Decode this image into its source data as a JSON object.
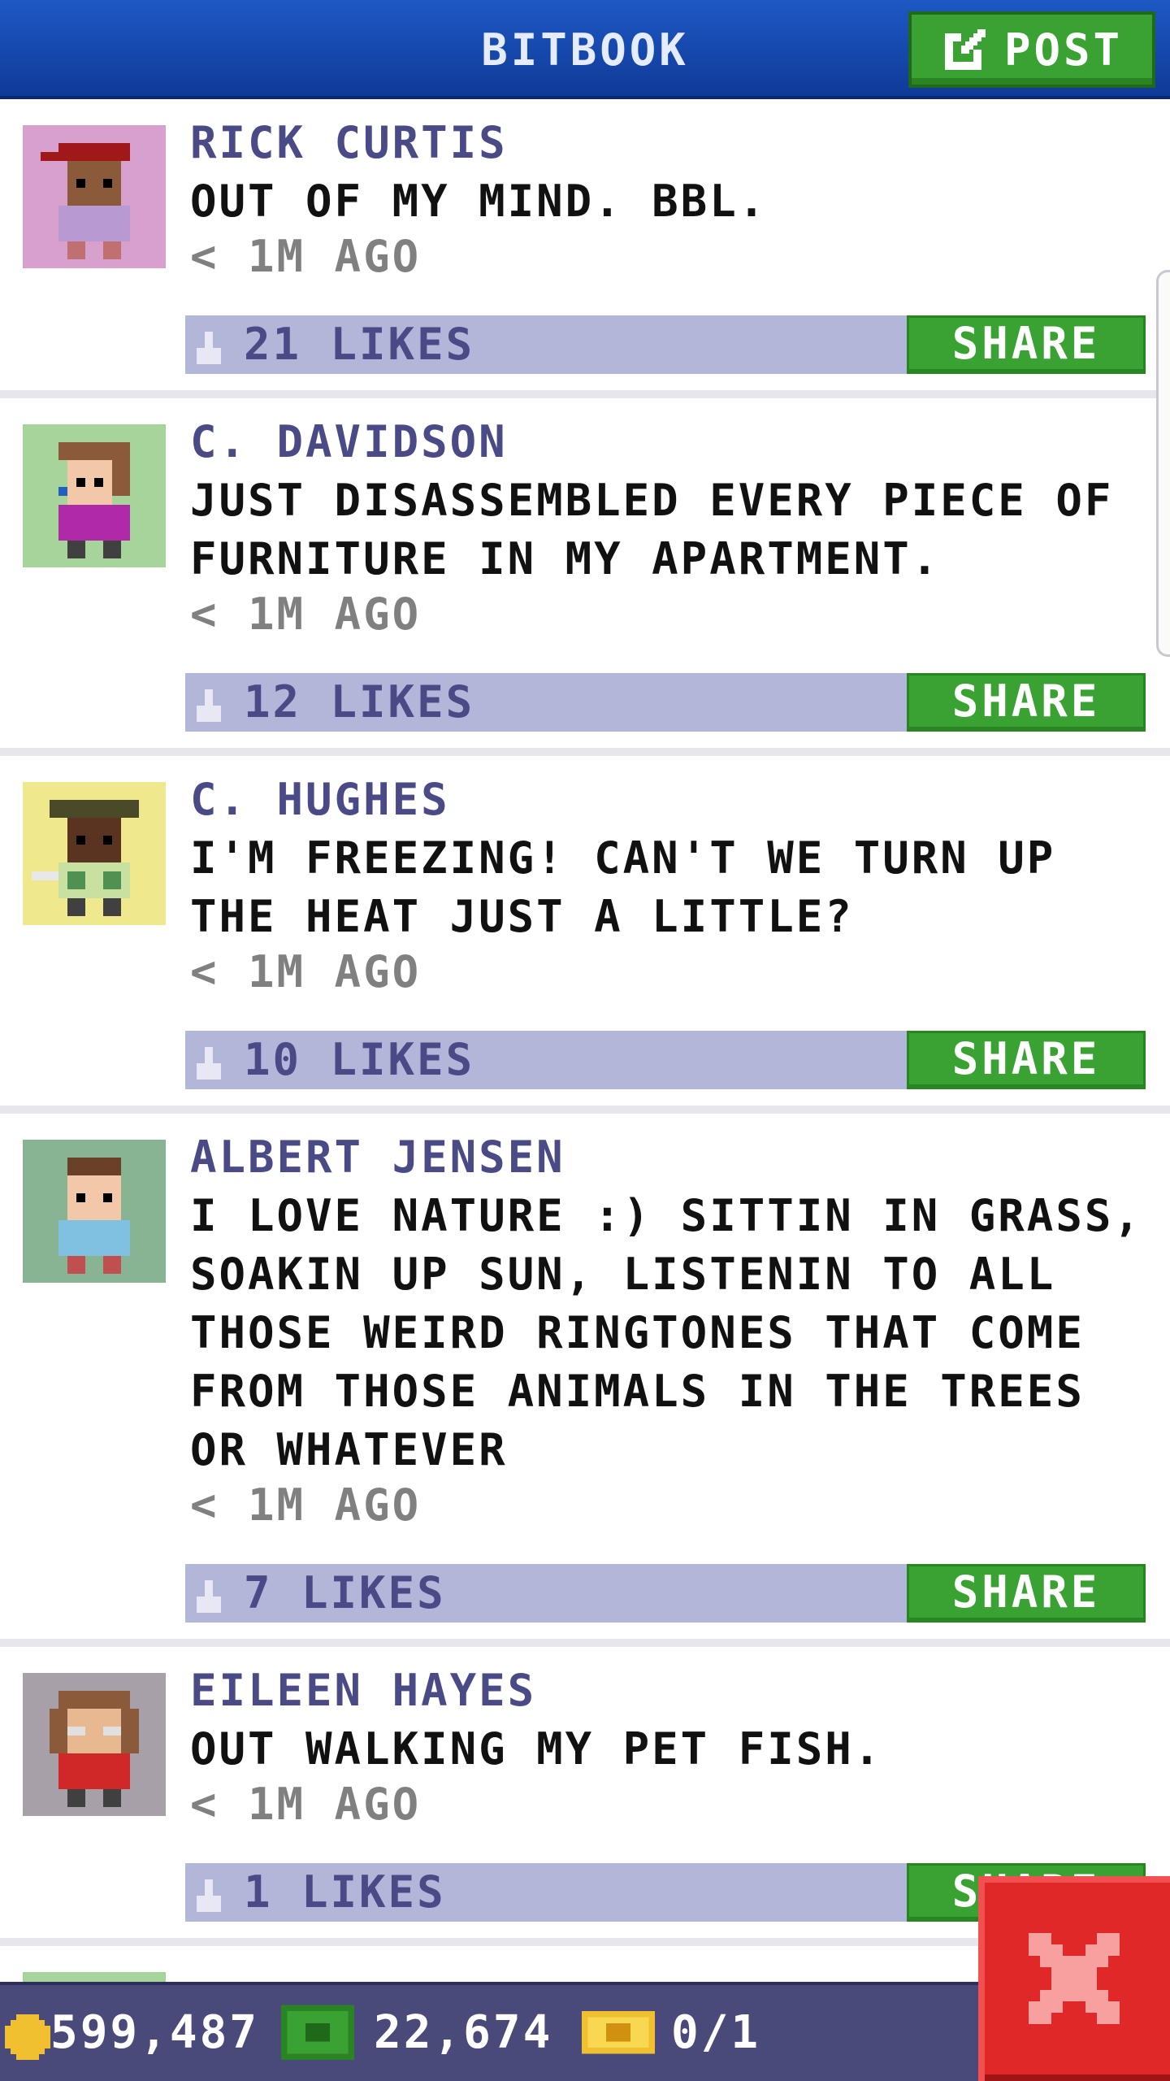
{
  "header": {
    "title": "BITBOOK",
    "post_label": "POST"
  },
  "posts": [
    {
      "author": "RICK CURTIS",
      "text": "OUT OF MY MIND. BBL.",
      "time": "< 1M AGO",
      "likes": "21 LIKES",
      "share_label": "SHARE",
      "avatar_bg": "#d8a0cc"
    },
    {
      "author": "C. DAVIDSON",
      "text": "JUST DISASSEMBLED EVERY PIECE OF FURNITURE IN MY APARTMENT.",
      "time": "< 1M AGO",
      "likes": "12 LIKES",
      "share_label": "SHARE",
      "avatar_bg": "#a6d49a"
    },
    {
      "author": "C. HUGHES",
      "text": "I'M FREEZING! CAN'T WE TURN UP THE HEAT JUST A LITTLE?",
      "time": "< 1M AGO",
      "likes": "10 LIKES",
      "share_label": "SHARE",
      "avatar_bg": "#f0e88c"
    },
    {
      "author": "ALBERT JENSEN",
      "text": "I LOVE NATURE :) SITTIN IN GRASS, SOAKIN UP SUN, LISTENIN TO ALL THOSE WEIRD RINGTONES THAT COME FROM THOSE ANIMALS IN THE TREES OR WHATEVER",
      "time": "< 1M AGO",
      "likes": "7 LIKES",
      "share_label": "SHARE",
      "avatar_bg": "#88b494"
    },
    {
      "author": "EILEEN HAYES",
      "text": "OUT WALKING MY PET FISH.",
      "time": "< 1M AGO",
      "likes": "1 LIKES",
      "share_label": "SHARE",
      "avatar_bg": "#a8a0a8"
    }
  ],
  "footer": {
    "coins": "599,487",
    "bux": "22,674",
    "tickets": "0/1"
  },
  "colors": {
    "header": "#1e58c4",
    "accent_green": "#3aa232",
    "likes_bar": "#b2b6d8",
    "close": "#e02828"
  },
  "icons": [
    "edit-icon",
    "like-icon",
    "coin-icon",
    "bux-icon",
    "ticket-icon",
    "close-icon"
  ]
}
